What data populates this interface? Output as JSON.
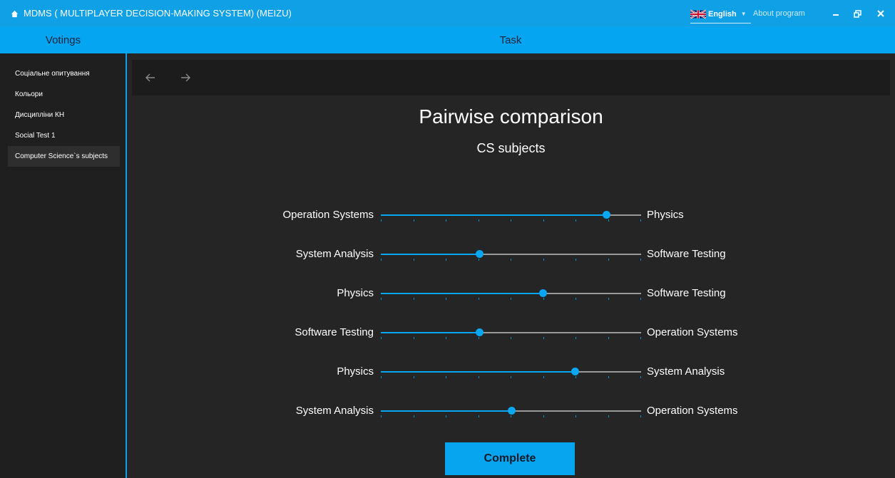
{
  "window": {
    "title": "MDMS ( MULTIPLAYER DECISION-MAKING SYSTEM)  (MEIZU)",
    "app_icon": "home-icon",
    "language": "English",
    "about": "About program",
    "controls": [
      "minimize-icon",
      "restore-icon",
      "close-icon"
    ]
  },
  "header": {
    "left": "Votings",
    "main": "Task"
  },
  "sidebar": {
    "items": [
      {
        "label": "Соціальне опитування",
        "active": false
      },
      {
        "label": "Кольори",
        "active": false
      },
      {
        "label": "Дисципліни КН",
        "active": false
      },
      {
        "label": "Social Test 1",
        "active": false
      },
      {
        "label": "Computer Science`s subjects",
        "active": true
      }
    ]
  },
  "main": {
    "title": "Pairwise comparison",
    "subtitle": "CS subjects",
    "comparisons": [
      {
        "left": "Operation Systems",
        "right": "Physics",
        "value": 0.867
      },
      {
        "left": "System Analysis",
        "right": "Software Testing",
        "value": 0.378
      },
      {
        "left": "Physics",
        "right": "Software Testing",
        "value": 0.622
      },
      {
        "left": "Software Testing",
        "right": "Operation Systems",
        "value": 0.378
      },
      {
        "left": "Physics",
        "right": "System Analysis",
        "value": 0.744
      },
      {
        "left": "System Analysis",
        "right": "Operation Systems",
        "value": 0.5
      }
    ],
    "tick_count": 9,
    "complete_label": "Complete"
  },
  "colors": {
    "accent": "#05a5f2",
    "background": "#252525",
    "sidebar": "#1f1f1f"
  }
}
